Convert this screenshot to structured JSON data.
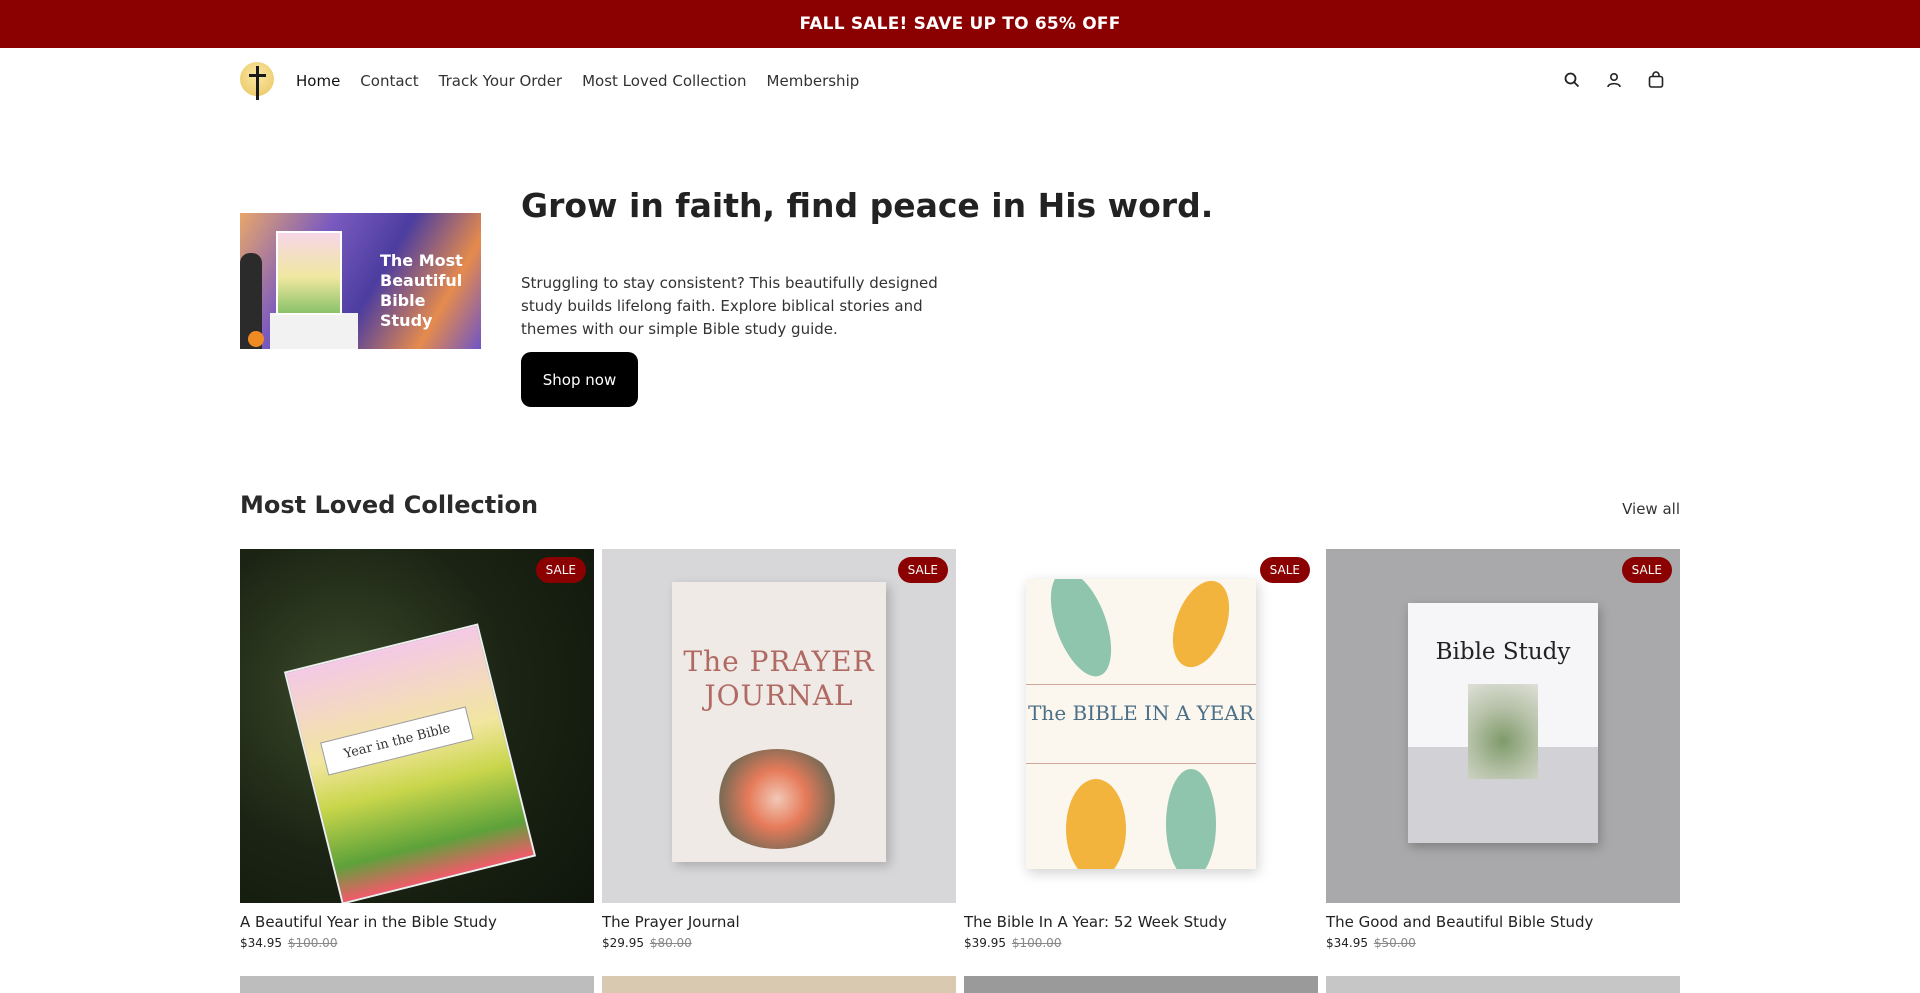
{
  "announcement": {
    "text": "FALL SALE! SAVE UP TO 65% OFF"
  },
  "header": {
    "nav": [
      {
        "label": "Home"
      },
      {
        "label": "Contact"
      },
      {
        "label": "Track Your Order"
      },
      {
        "label": "Most Loved Collection"
      },
      {
        "label": "Membership"
      }
    ],
    "icons": [
      "search-icon",
      "account-icon",
      "cart-icon"
    ]
  },
  "hero": {
    "image_text": "The Most Beautiful Bible Study",
    "title": "Grow in faith, find peace in His word.",
    "description": "Struggling to stay consistent? This beautifully designed study builds lifelong faith. Explore biblical stories and themes with our simple Bible study guide.",
    "button": "Shop now"
  },
  "collection": {
    "title": "Most Loved Collection",
    "view_all": "View all",
    "products": [
      {
        "name": "A Beautiful Year in the Bible Study",
        "price": "$34.95",
        "compare": "$100.00",
        "badge": "SALE",
        "cover_text": "Year in the Bible"
      },
      {
        "name": "The Prayer Journal",
        "price": "$29.95",
        "compare": "$80.00",
        "badge": "SALE",
        "cover_text": "The PRAYER JOURNAL"
      },
      {
        "name": "The Bible In A Year: 52 Week Study",
        "price": "$39.95",
        "compare": "$100.00",
        "badge": "SALE",
        "cover_text": "The BIBLE IN A YEAR"
      },
      {
        "name": "The Good and Beautiful Bible Study",
        "price": "$34.95",
        "compare": "$50.00",
        "badge": "SALE",
        "cover_text": "Bible Study"
      }
    ]
  },
  "colors": {
    "brand": "#8b0000",
    "button": "#000000"
  }
}
